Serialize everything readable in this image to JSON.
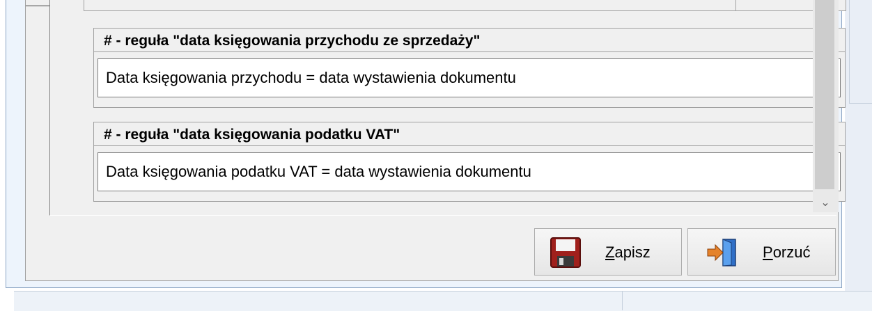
{
  "groups": [
    {
      "header": "# - reguła \"data księgowania przychodu ze sprzedaży\"",
      "selected_value": "Data księgowania przychodu = data wystawienia dokumentu"
    },
    {
      "header": "# - reguła \"data księgowania podatku VAT\"",
      "selected_value": "Data księgowania podatku VAT = data wystawienia dokumentu"
    }
  ],
  "buttons": {
    "save": {
      "mnemonic": "Z",
      "rest": "apisz",
      "icon": "floppy-disk-icon"
    },
    "discard": {
      "mnemonic": "P",
      "rest": "orzuć",
      "icon": "exit-door-icon"
    }
  },
  "icons": {
    "combo_arrow": "chevron-down-icon",
    "scroll_down": "scroll-down-arrow-icon"
  },
  "colors": {
    "dialog_bg": "#f0f0f0",
    "frame_blue": "#8aa4c4",
    "floppy_red": "#a0201c",
    "arrow_orange": "#e5822a"
  }
}
